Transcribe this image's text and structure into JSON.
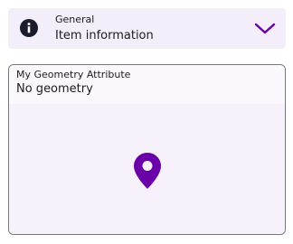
{
  "accordion": {
    "overline": "General",
    "title": "Item information",
    "info_icon": "info-icon",
    "expand_icon": "chevron-down-icon"
  },
  "geometry_card": {
    "label": "My Geometry Attribute",
    "value": "No geometry",
    "icon": "location-pin-icon"
  },
  "colors": {
    "accent": "#6a00a8",
    "icon_dark": "#1c1b2e",
    "surface": "#f3eef9",
    "border": "#79747e"
  }
}
